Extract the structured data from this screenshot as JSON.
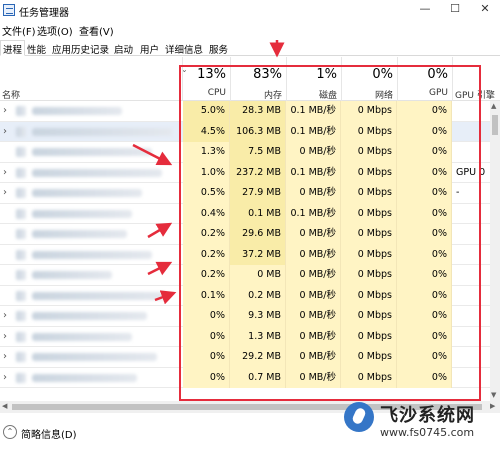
{
  "window": {
    "title": "任务管理器",
    "minimize": "—",
    "maximize": "☐",
    "close": "✕"
  },
  "menu": [
    "文件(F)",
    "选项(O)",
    "查看(V)"
  ],
  "tabs": [
    "进程",
    "性能",
    "应用历史记录",
    "启动",
    "用户",
    "详细信息",
    "服务"
  ],
  "header": {
    "name": "名称",
    "cpu": {
      "pct": "13%",
      "label": "CPU"
    },
    "mem": {
      "pct": "83%",
      "label": "内存"
    },
    "disk": {
      "pct": "1%",
      "label": "磁盘"
    },
    "net": {
      "pct": "0%",
      "label": "网络"
    },
    "gpu": {
      "pct": "0%",
      "label": "GPU"
    },
    "gpu_engine": {
      "label": "GPU 引擎"
    }
  },
  "rows": [
    {
      "cpu": "5.0%",
      "mem": "28.3 MB",
      "disk": "0.1 MB/秒",
      "net": "0 Mbps",
      "gpu": "0%",
      "gpu2": ""
    },
    {
      "cpu": "4.5%",
      "mem": "106.3 MB",
      "disk": "0.1 MB/秒",
      "net": "0 Mbps",
      "gpu": "0%",
      "gpu2": ""
    },
    {
      "cpu": "1.3%",
      "mem": "7.5 MB",
      "disk": "0 MB/秒",
      "net": "0 Mbps",
      "gpu": "0%",
      "gpu2": ""
    },
    {
      "cpu": "1.0%",
      "mem": "237.2 MB",
      "disk": "0.1 MB/秒",
      "net": "0 Mbps",
      "gpu": "0%",
      "gpu2": "GPU 0 -"
    },
    {
      "cpu": "0.5%",
      "mem": "27.9 MB",
      "disk": "0 MB/秒",
      "net": "0 Mbps",
      "gpu": "0%",
      "gpu2": ""
    },
    {
      "cpu": "0.4%",
      "mem": "0.1 MB",
      "disk": "0.1 MB/秒",
      "net": "0 Mbps",
      "gpu": "0%",
      "gpu2": ""
    },
    {
      "cpu": "0.2%",
      "mem": "29.6 MB",
      "disk": "0 MB/秒",
      "net": "0 Mbps",
      "gpu": "0%",
      "gpu2": ""
    },
    {
      "cpu": "0.2%",
      "mem": "37.2 MB",
      "disk": "0 MB/秒",
      "net": "0 Mbps",
      "gpu": "0%",
      "gpu2": ""
    },
    {
      "cpu": "0.2%",
      "mem": "0 MB",
      "disk": "0 MB/秒",
      "net": "0 Mbps",
      "gpu": "0%",
      "gpu2": ""
    },
    {
      "cpu": "0.1%",
      "mem": "0.2 MB",
      "disk": "0 MB/秒",
      "net": "0 Mbps",
      "gpu": "0%",
      "gpu2": ""
    },
    {
      "cpu": "0%",
      "mem": "9.3 MB",
      "disk": "0 MB/秒",
      "net": "0 Mbps",
      "gpu": "0%",
      "gpu2": ""
    },
    {
      "cpu": "0%",
      "mem": "1.3 MB",
      "disk": "0 MB/秒",
      "net": "0 Mbps",
      "gpu": "0%",
      "gpu2": ""
    },
    {
      "cpu": "0%",
      "mem": "29.2 MB",
      "disk": "0 MB/秒",
      "net": "0 Mbps",
      "gpu": "0%",
      "gpu2": ""
    },
    {
      "cpu": "0%",
      "mem": "0.7 MB",
      "disk": "0 MB/秒",
      "net": "0 Mbps",
      "gpu": "0%",
      "gpu2": ""
    }
  ],
  "footer": {
    "label": "简略信息(D)"
  },
  "watermark": {
    "title": "飞沙系统网",
    "url": "www.fs0745.com"
  },
  "colors": {
    "cell_bg": "#fff4c4",
    "cell_bg_alt": "#f9eca8",
    "highlight_box": "#e52c3c",
    "arrow": "#e52c3c"
  }
}
